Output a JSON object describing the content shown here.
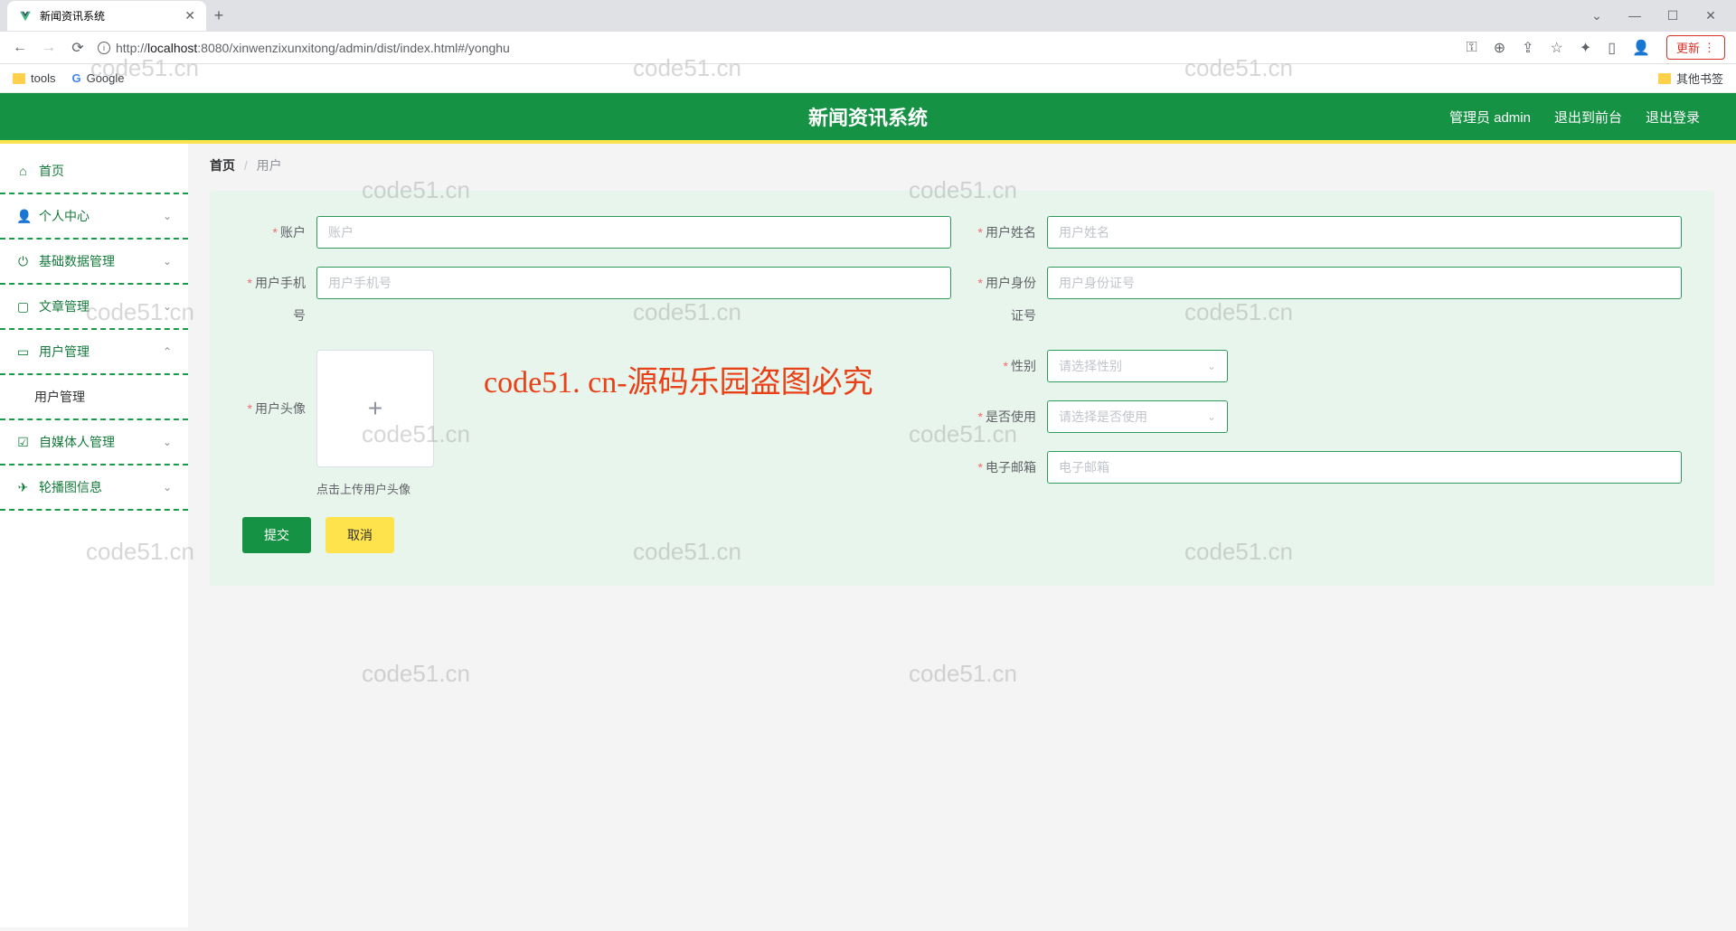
{
  "browser": {
    "tab_title": "新闻资讯系统",
    "url_prefix": "http://",
    "url_host": "localhost",
    "url_rest": ":8080/xinwenzixunxitong/admin/dist/index.html#/yonghu",
    "update_btn": "更新",
    "bookmarks": {
      "tools": "tools",
      "google": "Google",
      "other": "其他书签"
    }
  },
  "header": {
    "title": "新闻资讯系统",
    "admin": "管理员 admin",
    "to_front": "退出到前台",
    "logout": "退出登录"
  },
  "sidebar": {
    "items": [
      {
        "label": "首页"
      },
      {
        "label": "个人中心"
      },
      {
        "label": "基础数据管理"
      },
      {
        "label": "文章管理"
      },
      {
        "label": "用户管理"
      },
      {
        "label": "用户管理"
      },
      {
        "label": "自媒体人管理"
      },
      {
        "label": "轮播图信息"
      }
    ]
  },
  "breadcrumb": {
    "home": "首页",
    "current": "用户"
  },
  "form": {
    "account": {
      "label": "账户",
      "placeholder": "账户"
    },
    "username": {
      "label": "用户姓名",
      "placeholder": "用户姓名"
    },
    "phone": {
      "label": "用户手机号",
      "placeholder": "用户手机号"
    },
    "idcard": {
      "label": "用户身份证号",
      "placeholder": "用户身份证号"
    },
    "avatar": {
      "label": "用户头像",
      "hint": "点击上传用户头像"
    },
    "gender": {
      "label": "性别",
      "placeholder": "请选择性别"
    },
    "enabled": {
      "label": "是否使用",
      "placeholder": "请选择是否使用"
    },
    "email": {
      "label": "电子邮箱",
      "placeholder": "电子邮箱"
    },
    "submit": "提交",
    "cancel": "取消"
  },
  "watermark": {
    "text": "code51.cn",
    "red": "code51. cn-源码乐园盗图必究"
  }
}
